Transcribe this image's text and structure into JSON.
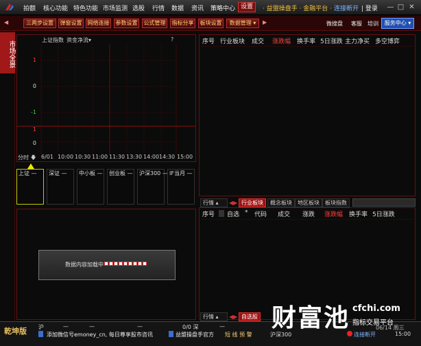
{
  "menu": {
    "items": [
      "拍额",
      "核心功能",
      "特色功能",
      "市场监测",
      "选股",
      "行情",
      "数据",
      "资讯",
      "策略中心",
      "设置"
    ],
    "app_title": "· 益盟操盘手 · 金融平台 ·",
    "link_status": "连接断开",
    "login": "| 登录"
  },
  "toolbar": {
    "buttons": [
      "三两步设置",
      "弹窗设置",
      "网络连接",
      "参数设置",
      "公式管理",
      "指标分享",
      "板块设置",
      "数据管理"
    ],
    "right_links": [
      "微搜盘",
      "客服",
      "培训"
    ],
    "service_center": "服务中心"
  },
  "side_tab": "市场全景",
  "chart": {
    "header_index": "上证指数",
    "header_metric": "资金净流",
    "help": "?",
    "y_ticks_top": [
      "1",
      "0",
      "-1"
    ],
    "y_ticks_bottom": [
      "1",
      "0"
    ],
    "x_label": "分时",
    "x_date": "6/01",
    "x_times": [
      "10:00",
      "10:30",
      "11:00",
      "11:30",
      "13:30",
      "14:00",
      "14:30",
      "15:00"
    ]
  },
  "index_boxes": [
    {
      "label": "上证",
      "val": "—"
    },
    {
      "label": "深证",
      "val": "—"
    },
    {
      "label": "中小板",
      "val": "—"
    },
    {
      "label": "创业板",
      "val": "—"
    },
    {
      "label": "沪深300",
      "val": "—"
    },
    {
      "label": "IF当月",
      "val": "—"
    }
  ],
  "loading": {
    "text": "数据内容加载中"
  },
  "sector_table": {
    "headers": [
      "序号",
      "行业板块",
      "成交",
      "涨跌幅",
      "换手率",
      "5日涨跌",
      "主力净买",
      "多空博弈"
    ],
    "tabs": [
      "行情",
      "行业板块",
      "概念板块",
      "地区板块",
      "板块指数"
    ]
  },
  "watch_table": {
    "headers": [
      "序号",
      "自选",
      "代码",
      "成交",
      "涨跌",
      "涨跌幅",
      "换手率",
      "5日涨跌"
    ],
    "tabs": [
      "行情",
      "自选股"
    ]
  },
  "status": {
    "edition": "乾坤版",
    "sh": "沪",
    "sz": "0/0 深",
    "news1": "添加微信号emoney_cn, 每日尊享股市咨讯",
    "news2": "益盟操盘手官方",
    "signals": "短 线 预 警",
    "hs300": "沪深300",
    "link_status": "连接断开",
    "date": "06/14 周三",
    "time": "15:00"
  },
  "watermark": {
    "logo_text": "财富池",
    "domain": "cfchi.com",
    "slogan": "指标交易平台"
  },
  "colors": {
    "accent": "#a01010",
    "rise": "#ff4040",
    "link": "#7fb7ff",
    "gold": "#f0c040"
  }
}
